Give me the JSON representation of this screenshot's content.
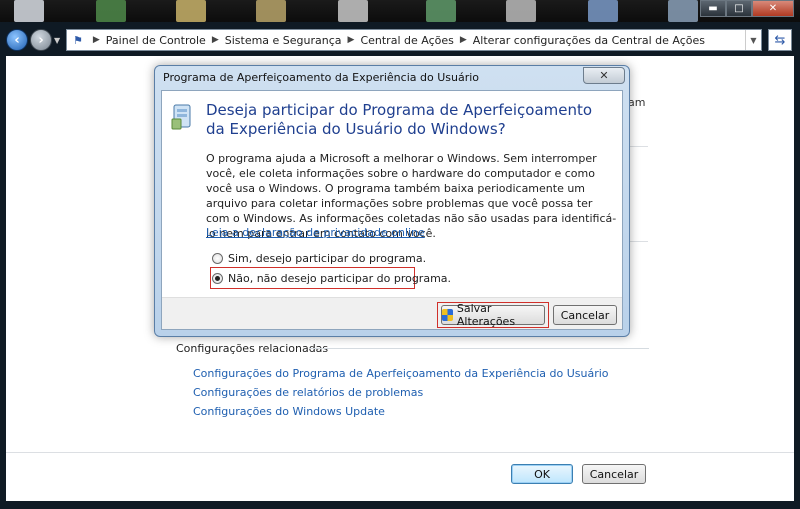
{
  "colors": {
    "link": "#1f5fb0",
    "heading": "#1f3f8f",
    "highlight": "#d0302a"
  },
  "window": {
    "controls": {
      "minimize": "▬",
      "maximize": "□",
      "close": "✕"
    }
  },
  "address_bar": {
    "breadcrumbs": [
      "Painel de Controle",
      "Sistema e Segurança",
      "Central de Ações",
      "Alterar configurações da Central de Ações"
    ]
  },
  "background_page": {
    "partial_text": "am",
    "related_title": "Configurações relacionadas",
    "related_links": [
      "Configurações do Programa de Aperfeiçoamento da Experiência do Usuário",
      "Configurações de relatórios de problemas",
      "Configurações do Windows Update"
    ],
    "ok_label": "OK",
    "cancel_label": "Cancelar"
  },
  "dialog": {
    "title": "Programa de Aperfeiçoamento da Experiência do Usuário",
    "close_label": "✕",
    "heading": "Deseja participar do Programa de Aperfeiçoamento da Experiência do Usuário do Windows?",
    "description": "O programa ajuda a Microsoft a melhorar o Windows. Sem interromper você, ele coleta informações sobre o hardware do computador e como você usa o Windows. O programa também baixa periodicamente um arquivo para coletar informações sobre problemas que você possa ter com o Windows. As informações coletadas não são usadas para identificá-lo nem para entrar em contato com você.",
    "privacy_link": "Leia a declaração de privacidade online",
    "option_yes": "Sim, desejo participar do programa.",
    "option_no": "Não, não desejo participar do programa.",
    "selected_option": "no",
    "save_label": "Salvar Alterações",
    "cancel_label": "Cancelar"
  }
}
